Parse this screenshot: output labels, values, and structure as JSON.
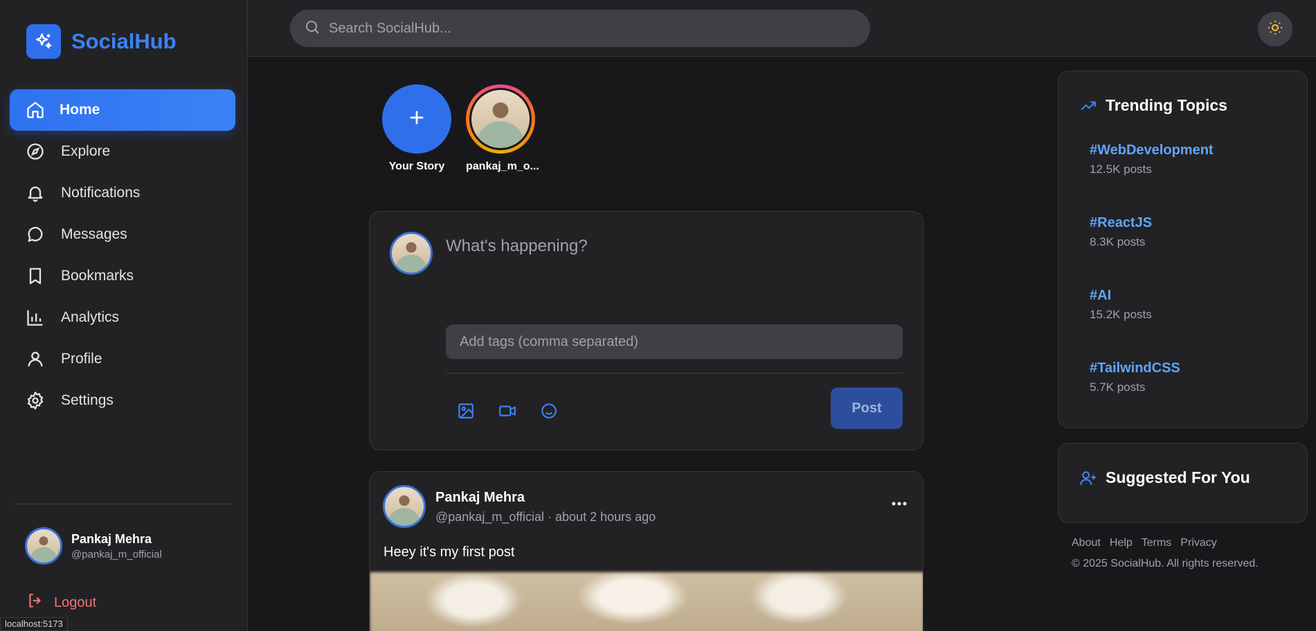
{
  "brand": {
    "name": "SocialHub"
  },
  "sidebar": {
    "items": [
      {
        "label": "Home",
        "icon": "home-icon"
      },
      {
        "label": "Explore",
        "icon": "compass-icon"
      },
      {
        "label": "Notifications",
        "icon": "bell-icon"
      },
      {
        "label": "Messages",
        "icon": "message-icon"
      },
      {
        "label": "Bookmarks",
        "icon": "bookmark-icon"
      },
      {
        "label": "Analytics",
        "icon": "bar-chart-icon"
      },
      {
        "label": "Profile",
        "icon": "user-icon"
      },
      {
        "label": "Settings",
        "icon": "gear-icon"
      }
    ],
    "active": "Home",
    "user": {
      "name": "Pankaj Mehra",
      "handle": "@pankaj_m_official"
    },
    "logout_label": "Logout"
  },
  "status_bar": {
    "url": "localhost:5173"
  },
  "search": {
    "placeholder": "Search SocialHub..."
  },
  "stories": [
    {
      "label": "Your Story"
    },
    {
      "label": "pankaj_m_o..."
    }
  ],
  "composer": {
    "placeholder": "What's happening?",
    "tags_placeholder": "Add tags (comma separated)",
    "post_label": "Post"
  },
  "post": {
    "author": "Pankaj Mehra",
    "meta": "@pankaj_m_official · about 2 hours ago",
    "text": "Heey it's my first post"
  },
  "trending": {
    "title": "Trending Topics",
    "topics": [
      {
        "tag": "#WebDevelopment",
        "count": "12.5K posts"
      },
      {
        "tag": "#ReactJS",
        "count": "8.3K posts"
      },
      {
        "tag": "#AI",
        "count": "15.2K posts"
      },
      {
        "tag": "#TailwindCSS",
        "count": "5.7K posts"
      }
    ]
  },
  "suggested": {
    "title": "Suggested For You"
  },
  "footer": {
    "links": [
      "About",
      "Help",
      "Terms",
      "Privacy"
    ],
    "copyright": "© 2025 SocialHub. All rights reserved."
  },
  "colors": {
    "accent": "#3b82f6",
    "danger": "#f87171",
    "background": "#18181b",
    "panel": "#222225"
  }
}
